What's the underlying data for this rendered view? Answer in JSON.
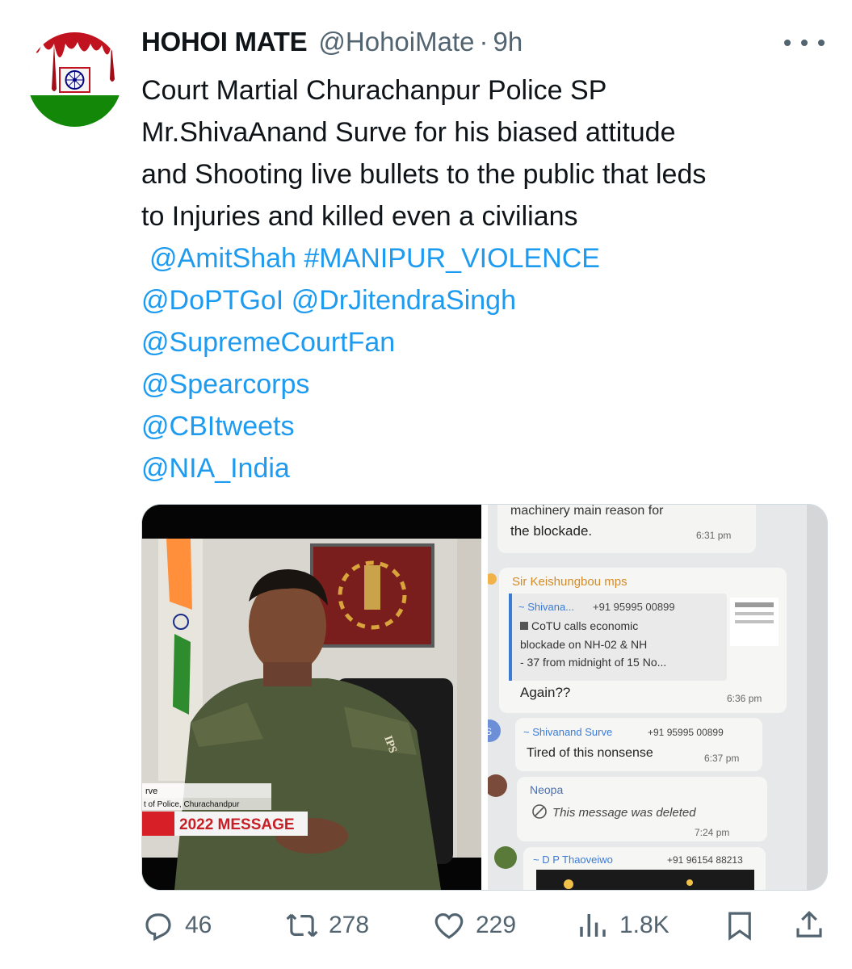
{
  "tweet": {
    "display_name": "HOHOI MATE",
    "handle": "@HohoiMate",
    "separator": "·",
    "time": "9h",
    "text_lines": [
      "Court Martial Churachanpur Police SP",
      "Mr.ShivaAnand Surve for his biased attitude",
      "and Shooting live bullets to the public that leds",
      "to Injuries and killed even a civilians"
    ],
    "mentions": {
      "amitshah": "@AmitShah",
      "hashtag": "#MANIPUR_VIOLENCE",
      "doptgoi": "@DoPTGoI",
      "drjitendra": "@DrJitendraSingh",
      "supremecourtfan": "@SupremeCourtFan",
      "spearcorps": "@Spearcorps",
      "cbitweets": "@CBItweets",
      "nia": "@NIA_India"
    }
  },
  "media": {
    "left": {
      "lower_third_name": "rve",
      "lower_third_title": "t of Police, Churachandpur",
      "banner": "2022 MESSAGE",
      "badge": "IPS"
    },
    "right": {
      "msg1_text_top": "machinery main reason for",
      "msg1_text": "the blockade.",
      "msg1_time": "6:31 pm",
      "msg2_sender": "Sir Keishungbou mps",
      "msg2_quote_name": "~ Shivana...",
      "msg2_quote_phone": "+91 95995 00899",
      "msg2_quote_line1": "CoTU calls economic",
      "msg2_quote_line2": "blockade on NH-02 & NH",
      "msg2_quote_line3": "- 37 from midnight of 15 No...",
      "msg2_text": "Again??",
      "msg2_time": "6:36 pm",
      "msg3_avatar": "S",
      "msg3_sender": "~ Shivanand Surve",
      "msg3_phone": "+91 95995 00899",
      "msg3_text": "Tired of this nonsense",
      "msg3_time": "6:37 pm",
      "msg4_sender": "Neopa",
      "msg4_text": "This message was deleted",
      "msg4_time": "7:24 pm",
      "msg5_sender": "~ D P Thaoveiwo",
      "msg5_phone": "+91 96154 88213"
    }
  },
  "actions": {
    "replies": "46",
    "reposts": "278",
    "likes": "229",
    "views": "1.8K"
  },
  "icons": {
    "reply": "reply-icon",
    "repost": "repost-icon",
    "like": "heart-icon",
    "views": "views-icon",
    "bookmark": "bookmark-icon",
    "share": "share-icon",
    "more": "more-icon"
  },
  "colors": {
    "link": "#1d9bf0",
    "secondary": "#536471",
    "saffron": "#ff9933",
    "india_green": "#138808",
    "chakra_blue": "#000080"
  }
}
